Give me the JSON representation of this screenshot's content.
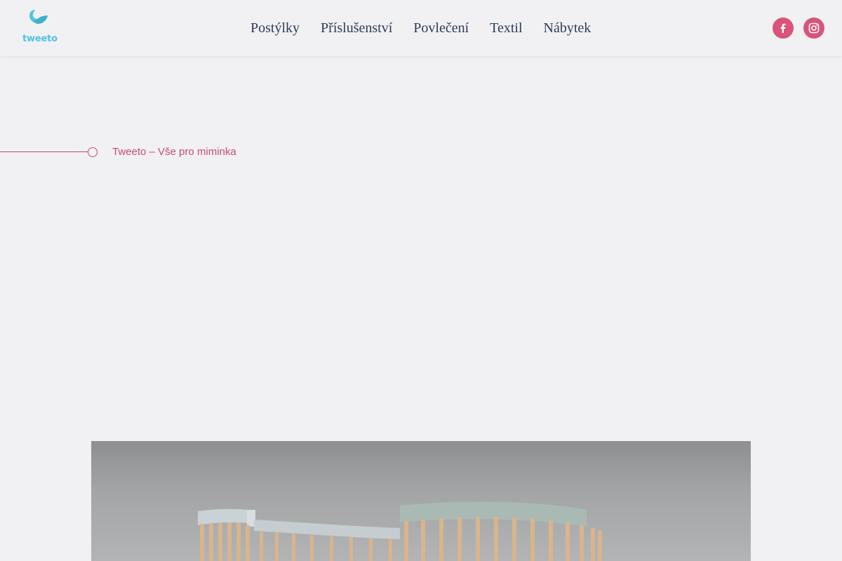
{
  "brand": {
    "name": "tweeto",
    "color": "#4fc3e0"
  },
  "nav": {
    "items": [
      {
        "label": "Postýlky"
      },
      {
        "label": "Příslušenství"
      },
      {
        "label": "Povlečení"
      },
      {
        "label": "Textil"
      },
      {
        "label": "Nábytek"
      }
    ]
  },
  "social": {
    "items": [
      {
        "icon": "facebook-icon"
      },
      {
        "icon": "instagram-icon"
      }
    ],
    "color": "#d9537b"
  },
  "tagline": {
    "text": "Tweeto – Vše pro miminka",
    "color": "#c74a6e"
  },
  "hero": {
    "subject": "crib-photo"
  }
}
